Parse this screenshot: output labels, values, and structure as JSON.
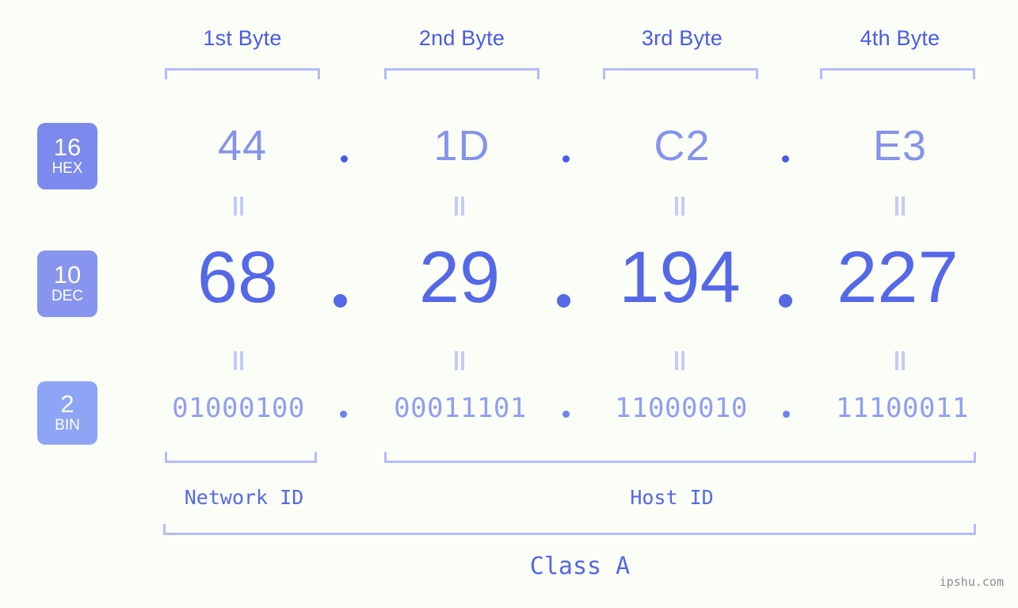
{
  "watermark": "ipshu.com",
  "byte_headers": [
    {
      "label": "1st Byte"
    },
    {
      "label": "2nd Byte"
    },
    {
      "label": "3rd Byte"
    },
    {
      "label": "4th Byte"
    }
  ],
  "rows": {
    "hex": {
      "base": "16",
      "name": "HEX",
      "values": [
        "44",
        "1D",
        "C2",
        "E3"
      ],
      "separator": "."
    },
    "dec": {
      "base": "10",
      "name": "DEC",
      "values": [
        "68",
        "29",
        "194",
        "227"
      ],
      "separator": "."
    },
    "bin": {
      "base": "2",
      "name": "BIN",
      "values": [
        "01000100",
        "00011101",
        "11000010",
        "11100011"
      ],
      "separator": "."
    }
  },
  "sections": {
    "network_id": "Network ID",
    "host_id": "Host ID",
    "class": "Class A"
  },
  "colors": {
    "background": "#fbfdf7",
    "accent_dark": "#5468e8",
    "accent_mid": "#7b8aec",
    "accent_light": "#8ea4f4",
    "bracket": "#b3bdfa",
    "equals": "#c3cbfb"
  },
  "chart_data": {
    "type": "table",
    "title": "IP address 68.29.194.227 byte breakdown",
    "columns": [
      "Byte",
      "HEX (base 16)",
      "DEC (base 10)",
      "BIN (base 2)"
    ],
    "rows": [
      [
        "1st Byte",
        "44",
        "68",
        "01000100"
      ],
      [
        "2nd Byte",
        "1D",
        "29",
        "00011101"
      ],
      [
        "3rd Byte",
        "C2",
        "194",
        "11000010"
      ],
      [
        "4th Byte",
        "E3",
        "227",
        "11100011"
      ]
    ],
    "annotations": {
      "network_id_bytes": [
        "1st Byte"
      ],
      "host_id_bytes": [
        "2nd Byte",
        "3rd Byte",
        "4th Byte"
      ],
      "class": "Class A"
    }
  }
}
